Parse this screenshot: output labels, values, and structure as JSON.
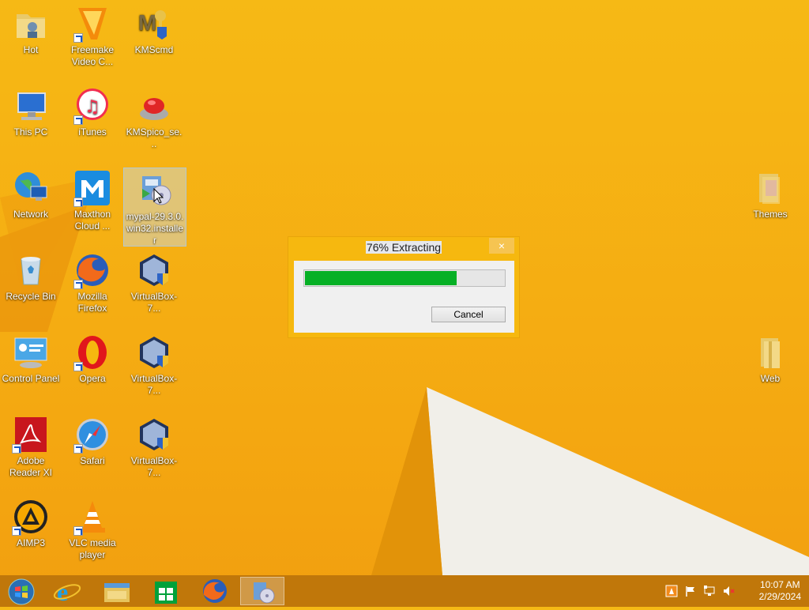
{
  "desktop": {
    "icons": [
      {
        "label": "Hot"
      },
      {
        "label": "Freemake Video C..."
      },
      {
        "label": "KMScmd"
      },
      {
        "label": "This PC"
      },
      {
        "label": "iTunes"
      },
      {
        "label": "KMSpico_se..."
      },
      {
        "label": "Network"
      },
      {
        "label": "Maxthon Cloud ..."
      },
      {
        "label": "mypal-29.3.0.win32.installer"
      },
      {
        "label": "Recycle Bin"
      },
      {
        "label": "Mozilla Firefox"
      },
      {
        "label": "VirtualBox-7..."
      },
      {
        "label": "Control Panel"
      },
      {
        "label": "Opera"
      },
      {
        "label": "VirtualBox-7..."
      },
      {
        "label": "Adobe Reader XI"
      },
      {
        "label": "Safari"
      },
      {
        "label": "VirtualBox-7..."
      },
      {
        "label": "AIMP3"
      },
      {
        "label": "VLC media player"
      },
      {
        "label": "Themes"
      },
      {
        "label": "Web"
      }
    ]
  },
  "dialog": {
    "title": "76% Extracting",
    "close_glyph": "×",
    "progress": 0.76,
    "cancel_label": "Cancel"
  },
  "taskbar": {
    "time": "10:07 AM",
    "date": "2/29/2024",
    "pinned": [
      "start",
      "internet-explorer",
      "file-explorer",
      "store",
      "firefox",
      "mypal-installer"
    ]
  },
  "colors": {
    "accent": "#f6b80f",
    "progress_fill": "#06b025"
  }
}
